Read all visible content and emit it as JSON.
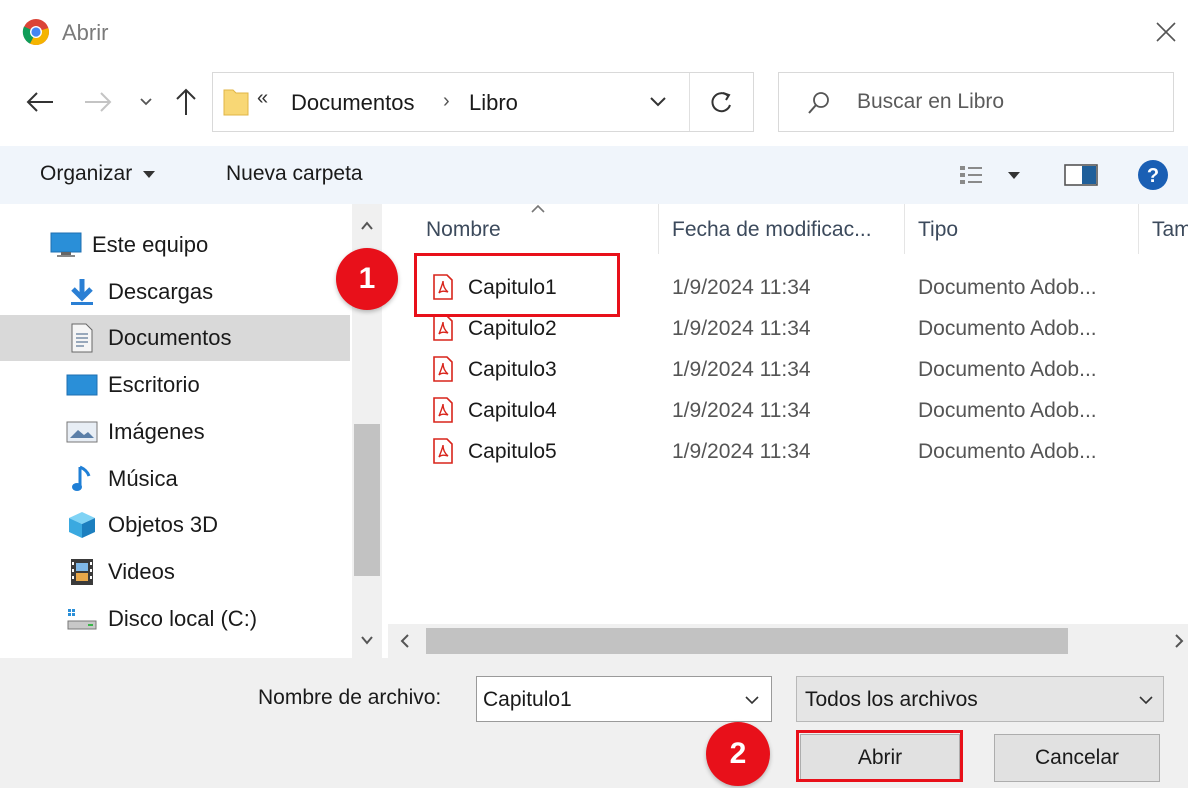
{
  "window": {
    "title": "Abrir"
  },
  "address": {
    "crumbs": [
      "Documentos",
      "Libro"
    ],
    "overflow_glyph": "«",
    "separator": "›"
  },
  "search": {
    "placeholder": "Buscar en Libro"
  },
  "toolbar": {
    "organize_label": "Organizar",
    "new_folder_label": "Nueva carpeta"
  },
  "sidebar": {
    "items": [
      {
        "label": "Este equipo",
        "icon": "computer-icon"
      },
      {
        "label": "Descargas",
        "icon": "download-icon"
      },
      {
        "label": "Documentos",
        "icon": "document-icon",
        "selected": true
      },
      {
        "label": "Escritorio",
        "icon": "desktop-icon"
      },
      {
        "label": "Imágenes",
        "icon": "pictures-icon"
      },
      {
        "label": "Música",
        "icon": "music-icon"
      },
      {
        "label": "Objetos 3D",
        "icon": "cube-icon"
      },
      {
        "label": "Videos",
        "icon": "video-icon"
      },
      {
        "label": "Disco local (C:)",
        "icon": "drive-icon"
      }
    ]
  },
  "filelist": {
    "columns": [
      "Nombre",
      "Fecha de modificac...",
      "Tipo",
      "Tam"
    ],
    "rows": [
      {
        "name": "Capitulo1",
        "date": "1/9/2024 11:34",
        "type": "Documento Adob..."
      },
      {
        "name": "Capitulo2",
        "date": "1/9/2024 11:34",
        "type": "Documento Adob..."
      },
      {
        "name": "Capitulo3",
        "date": "1/9/2024 11:34",
        "type": "Documento Adob..."
      },
      {
        "name": "Capitulo4",
        "date": "1/9/2024 11:34",
        "type": "Documento Adob..."
      },
      {
        "name": "Capitulo5",
        "date": "1/9/2024 11:34",
        "type": "Documento Adob..."
      }
    ]
  },
  "bottom": {
    "filename_label": "Nombre de archivo:",
    "filename_value": "Capitulo1",
    "filetype_value": "Todos los archivos",
    "open_label": "Abrir",
    "cancel_label": "Cancelar"
  },
  "annotations": {
    "step1": "1",
    "step2": "2",
    "highlight_color": "#e8101a"
  },
  "colors": {
    "toolbar_bg": "#f0f5fb",
    "selected_bg": "#d9d9d9",
    "pdf_red": "#d9251c",
    "help_blue": "#1a5fb4"
  }
}
